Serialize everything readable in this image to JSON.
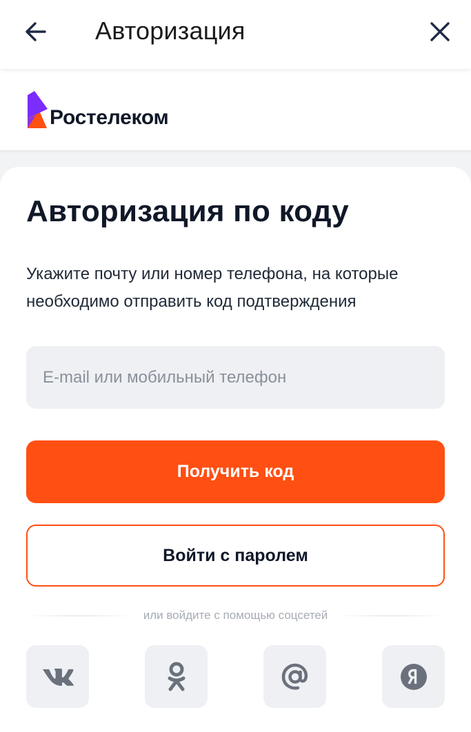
{
  "topbar": {
    "title": "Авторизация"
  },
  "brand": {
    "name": "Ростелеком",
    "colors": {
      "violet": "#7b2cff",
      "orange": "#ff4f12"
    }
  },
  "form": {
    "heading": "Авторизация по коду",
    "subtitle": "Укажите почту или номер телефона, на которые необходимо отправить код подтверждения",
    "input_placeholder": "E-mail или мобильный телефон",
    "input_value": "",
    "primary_label": "Получить код",
    "secondary_label": "Войти с паролем"
  },
  "social": {
    "divider_text": "или войдите с помощью соцсетей",
    "providers": [
      {
        "name": "vk-icon"
      },
      {
        "name": "odnoklassniki-icon"
      },
      {
        "name": "mail-ru-icon"
      },
      {
        "name": "yandex-icon"
      }
    ]
  },
  "colors": {
    "accent": "#ff4f12",
    "field_bg": "#eef0f3",
    "icon_gray": "#6b717c"
  }
}
